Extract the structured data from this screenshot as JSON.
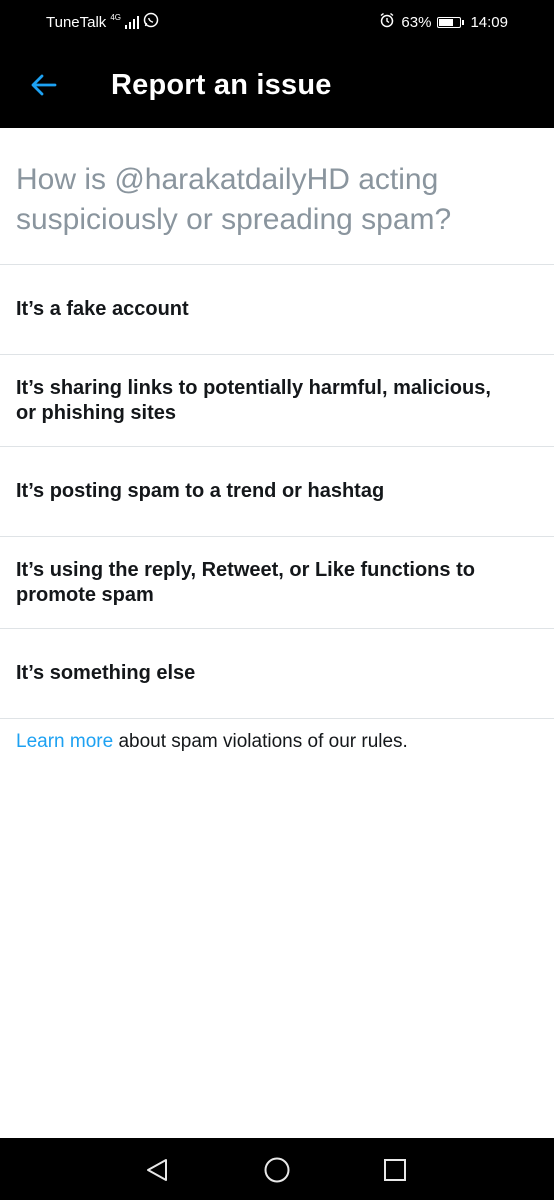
{
  "status_bar": {
    "carrier": "TuneTalk",
    "network_type": "4G",
    "battery": "63%",
    "time": "14:09",
    "icons": [
      "signal-icon",
      "whatsapp-icon",
      "alarm-icon",
      "battery-icon"
    ]
  },
  "header": {
    "back_icon": "arrow-left-icon",
    "title": "Report an issue"
  },
  "main": {
    "question": "How is @harakatdailyHD acting suspiciously or spreading spam?",
    "options": [
      {
        "label": "It’s a fake account"
      },
      {
        "label": "It’s sharing links to potentially harmful, malicious, or phishing sites"
      },
      {
        "label": "It’s posting spam to a trend or hashtag"
      },
      {
        "label": "It’s using the reply, Retweet, or Like functions to promote spam"
      },
      {
        "label": "It’s something else"
      }
    ],
    "footer": {
      "link_text": "Learn more",
      "rest_text": " about spam violations of our rules."
    }
  },
  "nav": {
    "icons": [
      "back-triangle-icon",
      "home-circle-icon",
      "recents-square-icon"
    ]
  },
  "colors": {
    "accent": "#1da1f2",
    "header_bg": "#000000",
    "question_text": "#8a959e",
    "option_text": "#14171a",
    "divider": "#dfe3e6"
  }
}
